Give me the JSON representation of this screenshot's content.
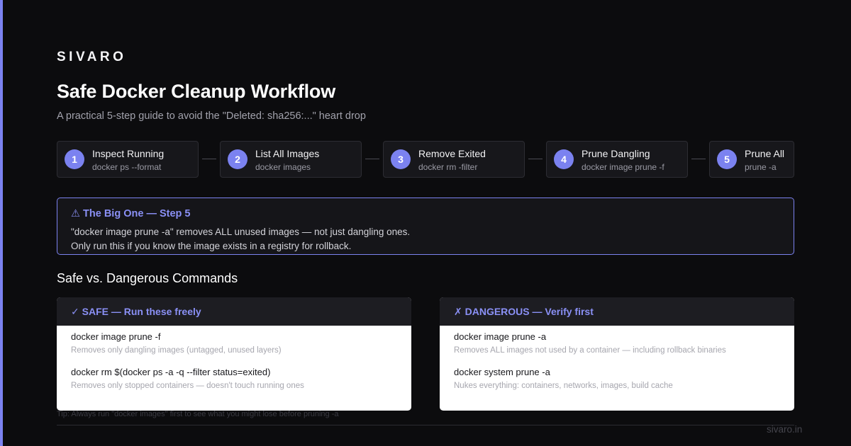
{
  "brand": "SIVARO",
  "title": "Safe Docker Cleanup Workflow",
  "subtitle": "A practical 5-step guide to avoid the \"Deleted: sha256:...\" heart drop",
  "steps": [
    {
      "num": "1",
      "label": "Inspect Running",
      "cmd": "docker ps --format"
    },
    {
      "num": "2",
      "label": "List All Images",
      "cmd": "docker images"
    },
    {
      "num": "3",
      "label": "Remove Exited",
      "cmd": "docker rm -filter"
    },
    {
      "num": "4",
      "label": "Prune Dangling",
      "cmd": "docker image prune -f"
    },
    {
      "num": "5",
      "label": "Prune All",
      "cmd": "prune -a"
    }
  ],
  "callout": {
    "title": "⚠ The Big One — Step 5",
    "line1": "\"docker image prune -a\" removes ALL unused images — not just dangling ones.",
    "line2": "Only run this if you know the image exists in a registry for rollback."
  },
  "section_heading": "Safe vs. Dangerous Commands",
  "safe": {
    "header": "✓ SAFE — Run these freely",
    "items": [
      {
        "cmd": "docker image prune -f",
        "desc": "Removes only dangling images (untagged, unused layers)"
      },
      {
        "cmd": "docker rm $(docker ps -a -q --filter status=exited)",
        "desc": "Removes only stopped containers — doesn't touch running ones"
      }
    ]
  },
  "dangerous": {
    "header": "✗ DANGEROUS — Verify first",
    "items": [
      {
        "cmd": "docker image prune -a",
        "desc": "Removes ALL images not used by a container — including rollback binaries"
      },
      {
        "cmd": "docker system prune -a",
        "desc": "Nukes everything: containers, networks, images, build cache"
      }
    ]
  },
  "tip": "Tip: Always run \"docker images\" first to see what you might lose before pruning -a",
  "footer_url": "sivaro.in",
  "colors": {
    "background": "#0c0c0e",
    "accent": "#7b82f0",
    "accent_text": "#8a90f5",
    "card": "#17171b",
    "panel_body": "#ffffff"
  }
}
